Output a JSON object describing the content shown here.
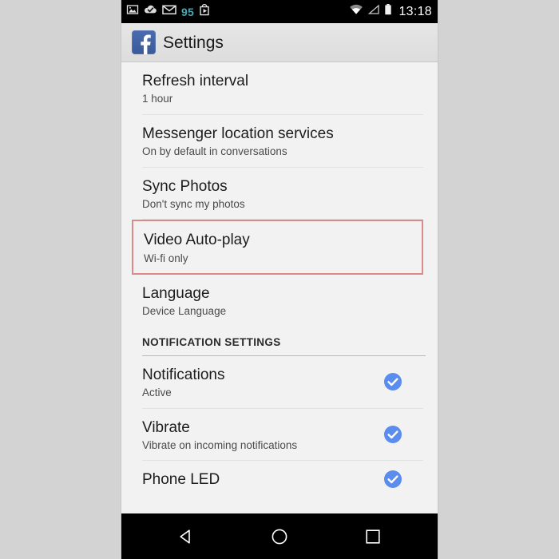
{
  "status_bar": {
    "icons_left": [
      "image-icon",
      "cloud-check-icon",
      "envelope-icon"
    ],
    "unread_count": "95",
    "play-store-icon": "play-store-icon",
    "icons_right": [
      "wifi-icon",
      "signal-icon",
      "battery-icon"
    ],
    "clock": "13:18"
  },
  "app_bar": {
    "logo": "facebook-logo",
    "title": "Settings"
  },
  "settings": {
    "items": [
      {
        "title": "Refresh interval",
        "sub": "1 hour",
        "checked": false,
        "highlighted": false
      },
      {
        "title": "Messenger location services",
        "sub": "On by default in conversations",
        "checked": false,
        "highlighted": false
      },
      {
        "title": "Sync Photos",
        "sub": "Don't sync my photos",
        "checked": false,
        "highlighted": false
      },
      {
        "title": "Video Auto-play",
        "sub": "Wi-fi only",
        "checked": false,
        "highlighted": true
      },
      {
        "title": "Language",
        "sub": "Device Language",
        "checked": false,
        "highlighted": false
      }
    ],
    "section_header": "NOTIFICATION SETTINGS",
    "notification_items": [
      {
        "title": "Notifications",
        "sub": "Active",
        "checked": true
      },
      {
        "title": "Vibrate",
        "sub": "Vibrate on incoming notifications",
        "checked": true
      },
      {
        "title": "Phone LED",
        "sub": "",
        "checked": true
      }
    ]
  },
  "nav_bar": {
    "back": "back-icon",
    "home": "home-icon",
    "recents": "recents-icon"
  },
  "colors": {
    "accent_check": "#5b8dee",
    "highlight_border": "#d98b8b",
    "status_count": "#4aa8b8",
    "facebook_blue": "#3b5a98"
  }
}
